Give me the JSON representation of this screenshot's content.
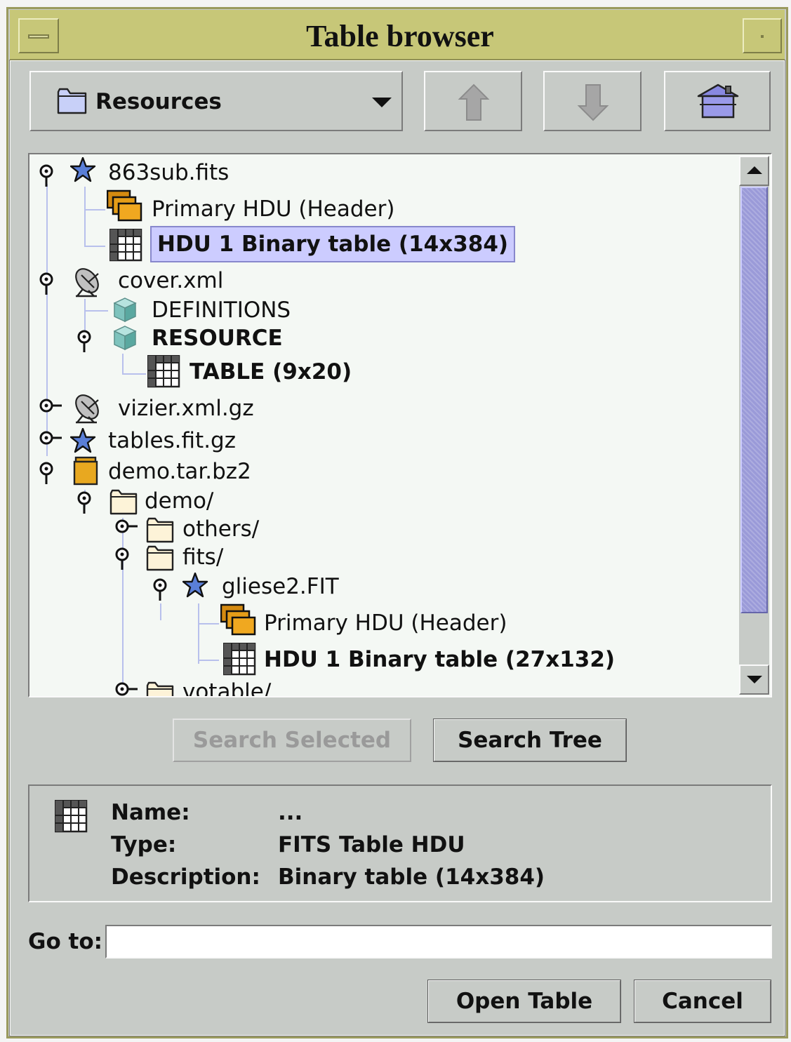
{
  "window": {
    "title": "Table browser"
  },
  "resource_combo": {
    "label": "Resources"
  },
  "tree": {
    "items": [
      "863sub.fits",
      "Primary HDU   (Header)",
      "HDU 1  Binary table (14x384)",
      "cover.xml",
      "DEFINITIONS",
      "RESOURCE",
      "TABLE  (9x20)",
      "vizier.xml.gz",
      "tables.fit.gz",
      "demo.tar.bz2",
      "demo/",
      "others/",
      "fits/",
      "gliese2.FIT",
      "Primary HDU   (Header)",
      "HDU 1  Binary table (27x132)",
      "votable/"
    ]
  },
  "search": {
    "selected_label": "Search Selected",
    "tree_label": "Search Tree"
  },
  "info": {
    "name_label": "Name:",
    "name_value": "...",
    "type_label": "Type:",
    "type_value": "FITS Table HDU",
    "desc_label": "Description:",
    "desc_value": "Binary table (14x384)"
  },
  "goto": {
    "label": "Go to:",
    "value": ""
  },
  "footer": {
    "open_label": "Open Table",
    "cancel_label": "Cancel"
  },
  "colors": {
    "title_bar": "#c7c778",
    "panel": "#c7cbc7",
    "selection": "#ccccff",
    "scroll_thumb": "#9a9ad8"
  }
}
